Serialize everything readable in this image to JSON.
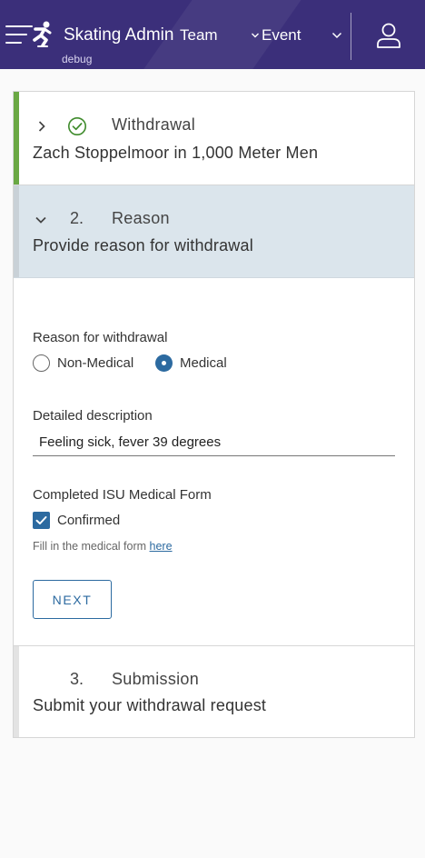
{
  "header": {
    "app_title": "Skating Admin",
    "env_label": "debug",
    "nav_team": "Team",
    "nav_event": "Event",
    "icons": [
      "menu-icon",
      "skater-icon",
      "chevron-down-icon",
      "user-icon"
    ],
    "background_color": "#3b2f7a"
  },
  "steps": [
    {
      "number": "",
      "title": "Withdrawal",
      "subtitle": "Zach Stoppelmoor in 1,000 Meter Men",
      "status": "complete",
      "expanded": false,
      "status_icon": "check-circle-icon",
      "accent_color": "#6aa844"
    },
    {
      "number": "2.",
      "title": "Reason",
      "subtitle": "Provide reason for withdrawal",
      "status": "active",
      "expanded": true
    },
    {
      "number": "3.",
      "title": "Submission",
      "subtitle": "Submit your withdrawal request",
      "status": "pending",
      "expanded": false
    }
  ],
  "form": {
    "reason_label": "Reason for withdrawal",
    "reason_options": [
      "Non-Medical",
      "Medical"
    ],
    "reason_selected": "Medical",
    "description_label": "Detailed description",
    "description_value": "Feeling sick, fever 39 degrees",
    "medical_form_label": "Completed ISU Medical Form",
    "confirmed_label": "Confirmed",
    "confirmed_checked": true,
    "hint_text": "Fill in the medical form",
    "hint_link": "here",
    "next_button": "NEXT",
    "accent_color": "#2c6aa0"
  }
}
